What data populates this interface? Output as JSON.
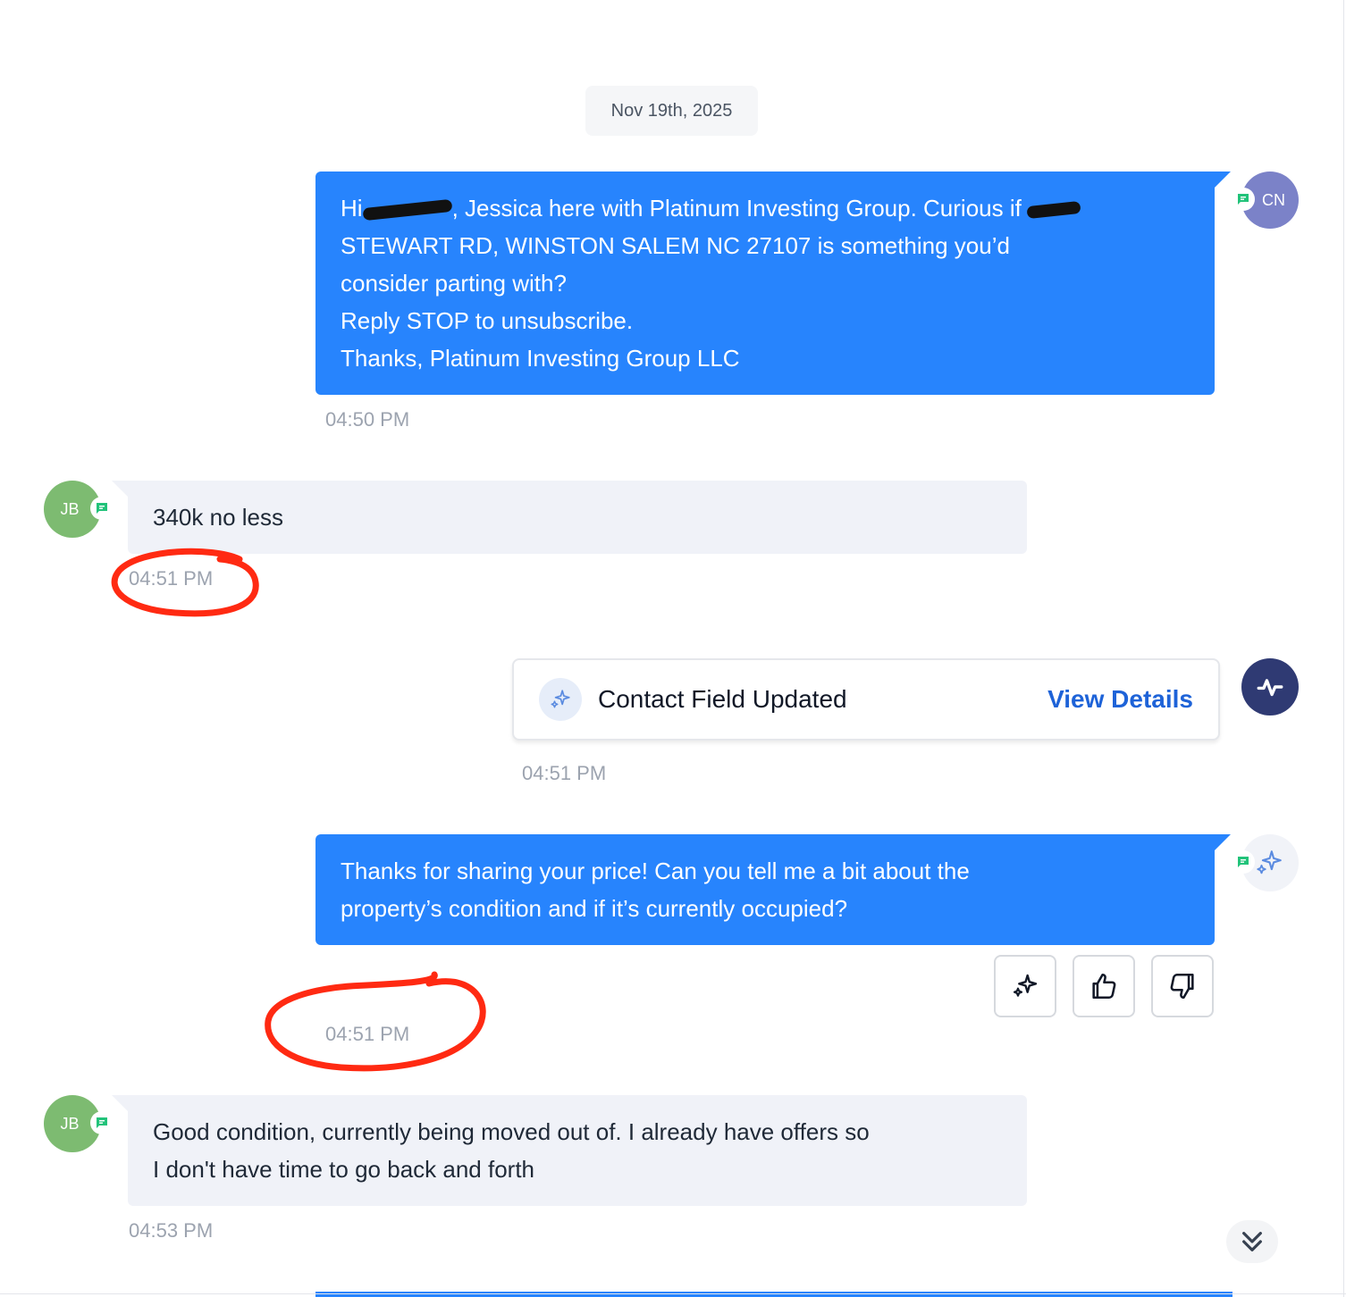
{
  "date_separator": "Nov 19th, 2025",
  "messages": {
    "m1": {
      "direction": "outgoing",
      "avatar_initials": "CN",
      "line1_a": "Hi",
      "line1_b": ", Jessica here with Platinum Investing Group. Curious if",
      "line2": "STEWART RD, WINSTON SALEM NC 27107 is something you’d",
      "line3": "consider parting with?",
      "line4": "Reply STOP to unsubscribe.",
      "line5": "Thanks, Platinum Investing Group LLC",
      "time": "04:50 PM"
    },
    "m2": {
      "direction": "incoming",
      "avatar_initials": "JB",
      "text": "340k no less",
      "time": "04:51 PM"
    },
    "m3": {
      "type": "event",
      "title": "Contact Field Updated",
      "action": "View Details",
      "time": "04:51 PM"
    },
    "m4": {
      "direction": "outgoing",
      "sender": "ai",
      "line1": "Thanks for sharing your price! Can you tell me a bit about the",
      "line2": "property’s condition and if it’s currently occupied?",
      "time": "04:51 PM"
    },
    "m5": {
      "direction": "incoming",
      "avatar_initials": "JB",
      "line1": "Good condition, currently being moved out of. I already have offers so",
      "line2": "I don't have time to go back and forth",
      "time": "04:53 PM"
    }
  },
  "icons": {
    "sms_badge": "chat-square-icon",
    "event_avatar": "activity-pulse-icon",
    "event_icon": "sparkles-icon",
    "ai_avatar": "sparkles-icon",
    "action_buttons": [
      "sparkles-icon",
      "thumbs-up-icon",
      "thumbs-down-icon"
    ],
    "scroll": "double-chevron-down-icon"
  },
  "colors": {
    "outgoing_bubble": "#2784fd",
    "incoming_bubble": "#f0f2f8",
    "link": "#1e63d8",
    "cn_avatar": "#7b82c8",
    "jb_avatar": "#7dbb71",
    "event_avatar": "#2f3a73",
    "sms_badge": "#22c37a",
    "annotation": "#ff2a12"
  }
}
